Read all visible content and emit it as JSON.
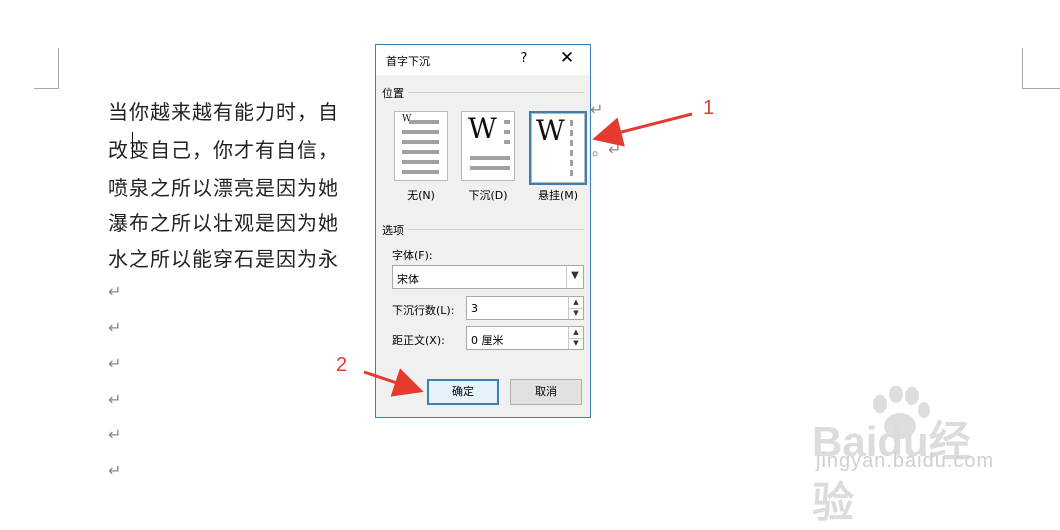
{
  "document": {
    "lines": [
      "当你越来越有能力时，自",
      "改变自己，你才有自信，",
      "喷泉之所以漂亮是因为她",
      "瀑布之所以壮观是因为她",
      "水之所以能穿石是因为永"
    ],
    "line1_trail": "↵",
    "line2_trail": "。↵",
    "paragraph_mark": "↵"
  },
  "dialog": {
    "title": "首字下沉",
    "help": "?",
    "close": "✕",
    "position_label": "位置",
    "options": [
      {
        "label": "无(N)",
        "icon": "drop-cap-none-icon"
      },
      {
        "label": "下沉(D)",
        "icon": "drop-cap-dropped-icon"
      },
      {
        "label": "悬挂(M)",
        "icon": "drop-cap-in-margin-icon",
        "selected": true
      }
    ],
    "preview_letter": "W",
    "options_label": "选项",
    "font_label": "字体(F):",
    "font_value": "宋体",
    "lines_label": "下沉行数(L):",
    "lines_value": "3",
    "distance_label": "距正文(X):",
    "distance_value": "0 厘米",
    "ok_label": "确定",
    "cancel_label": "取消"
  },
  "annotations": {
    "one": "1",
    "two": "2",
    "color": "#e53a2e"
  },
  "watermark": {
    "brand": "Baidu经验",
    "url": "jingyan.baidu.com"
  }
}
